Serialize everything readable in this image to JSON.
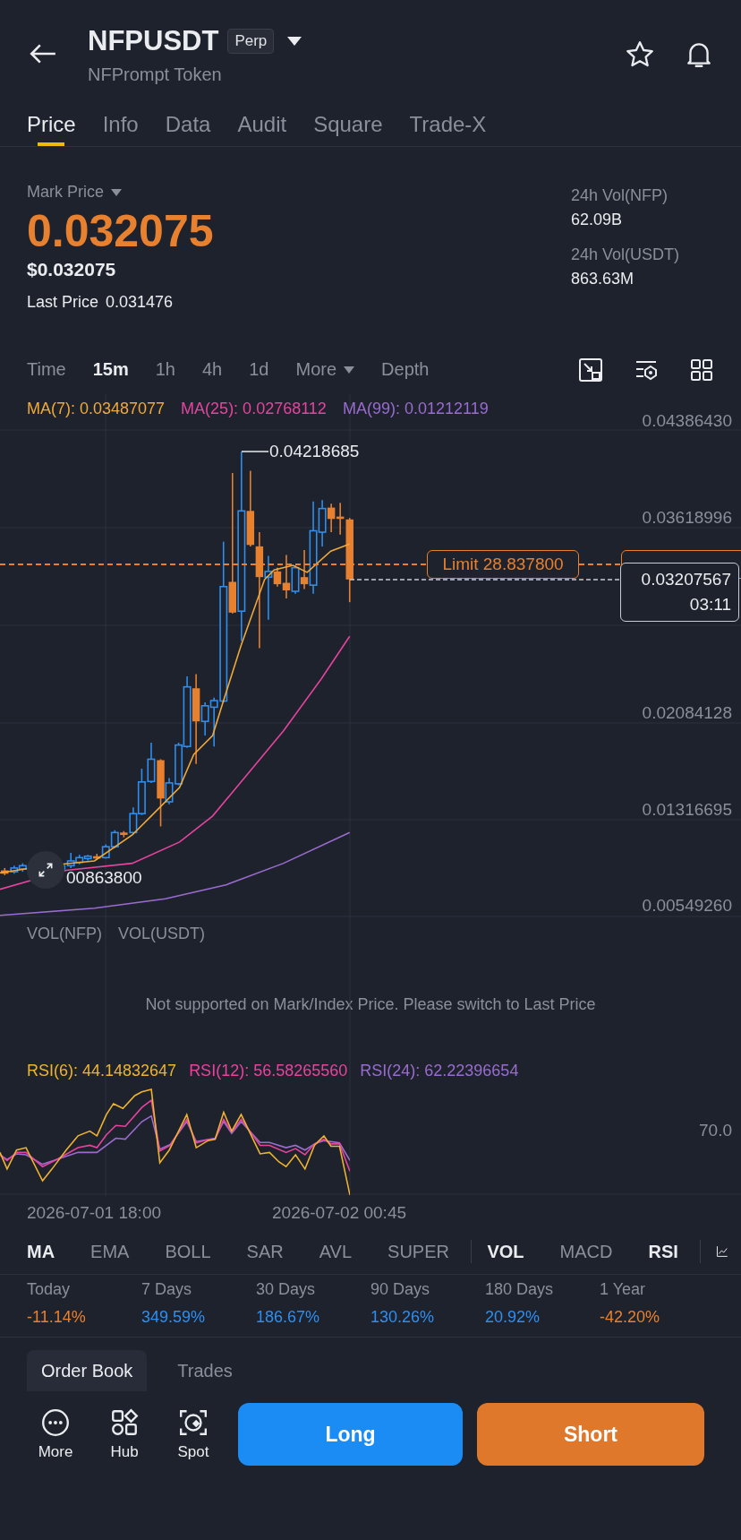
{
  "header": {
    "title": "NFPUSDT",
    "badge": "Perp",
    "subtitle": "NFPrompt Token"
  },
  "tabs": [
    {
      "label": "Price",
      "selected": true
    },
    {
      "label": "Info",
      "selected": false
    },
    {
      "label": "Data",
      "selected": false
    },
    {
      "label": "Audit",
      "selected": false
    },
    {
      "label": "Square",
      "selected": false
    },
    {
      "label": "Trade-X",
      "selected": false
    }
  ],
  "price": {
    "mark_label": "Mark Price",
    "mark_price": "0.032075",
    "usd_price": "$0.032075",
    "last_price_label": "Last Price",
    "last_price": "0.031476"
  },
  "volumes": [
    {
      "label": "24h Vol(NFP)",
      "value": "62.09B"
    },
    {
      "label": "24h Vol(USDT)",
      "value": "863.63M"
    }
  ],
  "intervals": [
    {
      "label": "Time",
      "selected": false,
      "kind": "option"
    },
    {
      "label": "15m",
      "selected": true,
      "kind": "option"
    },
    {
      "label": "1h",
      "selected": false,
      "kind": "option"
    },
    {
      "label": "4h",
      "selected": false,
      "kind": "option"
    },
    {
      "label": "1d",
      "selected": false,
      "kind": "option"
    },
    {
      "label": "More",
      "selected": false,
      "kind": "dropdown"
    },
    {
      "label": "Depth",
      "selected": false,
      "kind": "option"
    }
  ],
  "chart": {
    "ma_legend": [
      {
        "text": "MA(7): 0.03487077",
        "color": "#f0a93a"
      },
      {
        "text": "MA(25): 0.02768112",
        "color": "#e6449e"
      },
      {
        "text": "MA(99): 0.01212119",
        "color": "#9a6cd0"
      }
    ],
    "y_axis": [
      "0.04386430",
      "0.03618996",
      "0.02084128",
      "0.01316695",
      "0.00549260"
    ],
    "high_label": "0.04218685",
    "low_label": "00863800",
    "limit_label": "Limit 28.837800",
    "current_price": "0.03207567",
    "countdown": "03:11"
  },
  "volume": {
    "labels": [
      "VOL(NFP)",
      "VOL(USDT)"
    ],
    "message": "Not supported on Mark/Index Price. Please switch to Last Price"
  },
  "rsi": {
    "legend": [
      {
        "text": "RSI(6): 44.14832647",
        "color": "#f0b330"
      },
      {
        "text": "RSI(12): 56.58265560",
        "color": "#e6449e"
      },
      {
        "text": "RSI(24): 62.22396654",
        "color": "#9a6cd0"
      }
    ],
    "level_label": "70.0"
  },
  "time_axis": [
    "2026-07-01 18:00",
    "2026-07-02 00:45"
  ],
  "main_indicators": [
    {
      "label": "MA",
      "selected": true
    },
    {
      "label": "EMA",
      "selected": false
    },
    {
      "label": "BOLL",
      "selected": false
    },
    {
      "label": "SAR",
      "selected": false
    },
    {
      "label": "AVL",
      "selected": false
    },
    {
      "label": "SUPER",
      "selected": false
    }
  ],
  "sub_indicators": [
    {
      "label": "VOL",
      "selected": true
    },
    {
      "label": "MACD",
      "selected": false
    },
    {
      "label": "RSI",
      "selected": true
    }
  ],
  "performance": [
    {
      "period": "Today",
      "value": "-11.14%",
      "color": "#e8812f"
    },
    {
      "period": "7 Days",
      "value": "349.59%",
      "color": "#2e8ff0"
    },
    {
      "period": "30 Days",
      "value": "186.67%",
      "color": "#2e8ff0"
    },
    {
      "period": "90 Days",
      "value": "130.26%",
      "color": "#2e8ff0"
    },
    {
      "period": "180 Days",
      "value": "20.92%",
      "color": "#2e8ff0"
    },
    {
      "period": "1 Year",
      "value": "-42.20%",
      "color": "#e8812f"
    }
  ],
  "book_tabs": [
    {
      "label": "Order Book",
      "selected": true
    },
    {
      "label": "Trades",
      "selected": false
    }
  ],
  "actions": [
    {
      "label": "More",
      "kind": "more"
    },
    {
      "label": "Hub",
      "kind": "hub"
    },
    {
      "label": "Spot",
      "kind": "spot"
    }
  ],
  "trade_buttons": [
    {
      "label": "Long",
      "kind": "long"
    },
    {
      "label": "Short",
      "kind": "short"
    }
  ]
}
